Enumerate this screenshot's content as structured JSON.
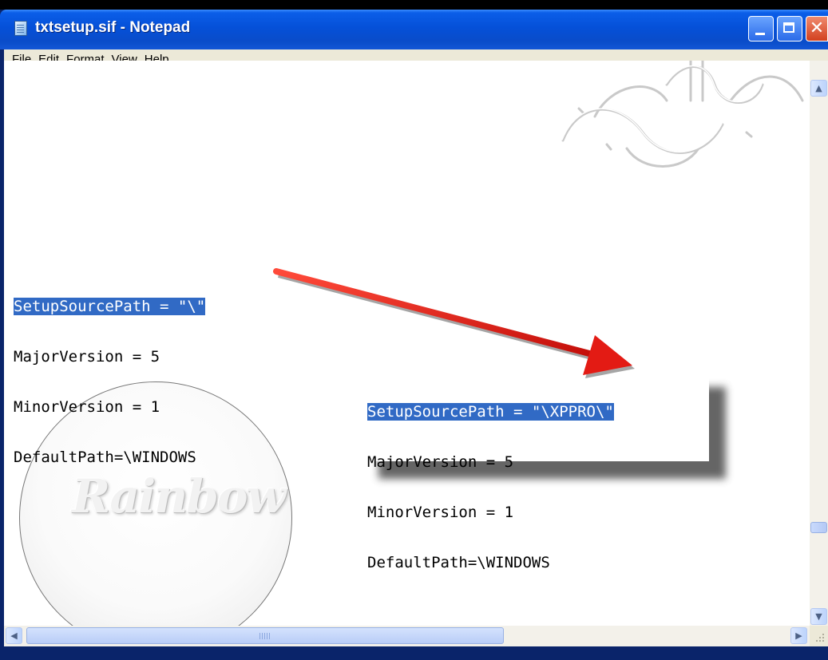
{
  "window": {
    "title": "txtsetup.sif - Notepad",
    "icon": "notepad-icon",
    "controls": [
      "minimize-icon",
      "maximize-icon",
      "close-icon"
    ],
    "close_glyph": "✕"
  },
  "menu": [
    "File",
    "Edit",
    "Format",
    "View",
    "Help"
  ],
  "editor": {
    "original_lines": [
      {
        "selected": "SetupSourcePath = \"\\\"",
        "rest": ""
      },
      {
        "selected": "",
        "rest": "MajorVersion = 5"
      },
      {
        "selected": "",
        "rest": "MinorVersion = 1"
      },
      {
        "selected": "",
        "rest": "DefaultPath=\\WINDOWS"
      }
    ]
  },
  "callout": {
    "lines": [
      {
        "selected": "SetupSourcePath = \"\\XPPRO\\\"",
        "rest": ""
      },
      {
        "selected": "",
        "rest": "MajorVersion = 5"
      },
      {
        "selected": "",
        "rest": "MinorVersion = 1"
      },
      {
        "selected": "",
        "rest": "DefaultPath=\\WINDOWS"
      }
    ],
    "arrow_color": "#e31b14"
  },
  "watermark": {
    "logo_text": "Rainbow"
  },
  "colors": {
    "selection": "#316ac5",
    "titlebar": "#0550d8",
    "menubar": "#ece9d8"
  }
}
